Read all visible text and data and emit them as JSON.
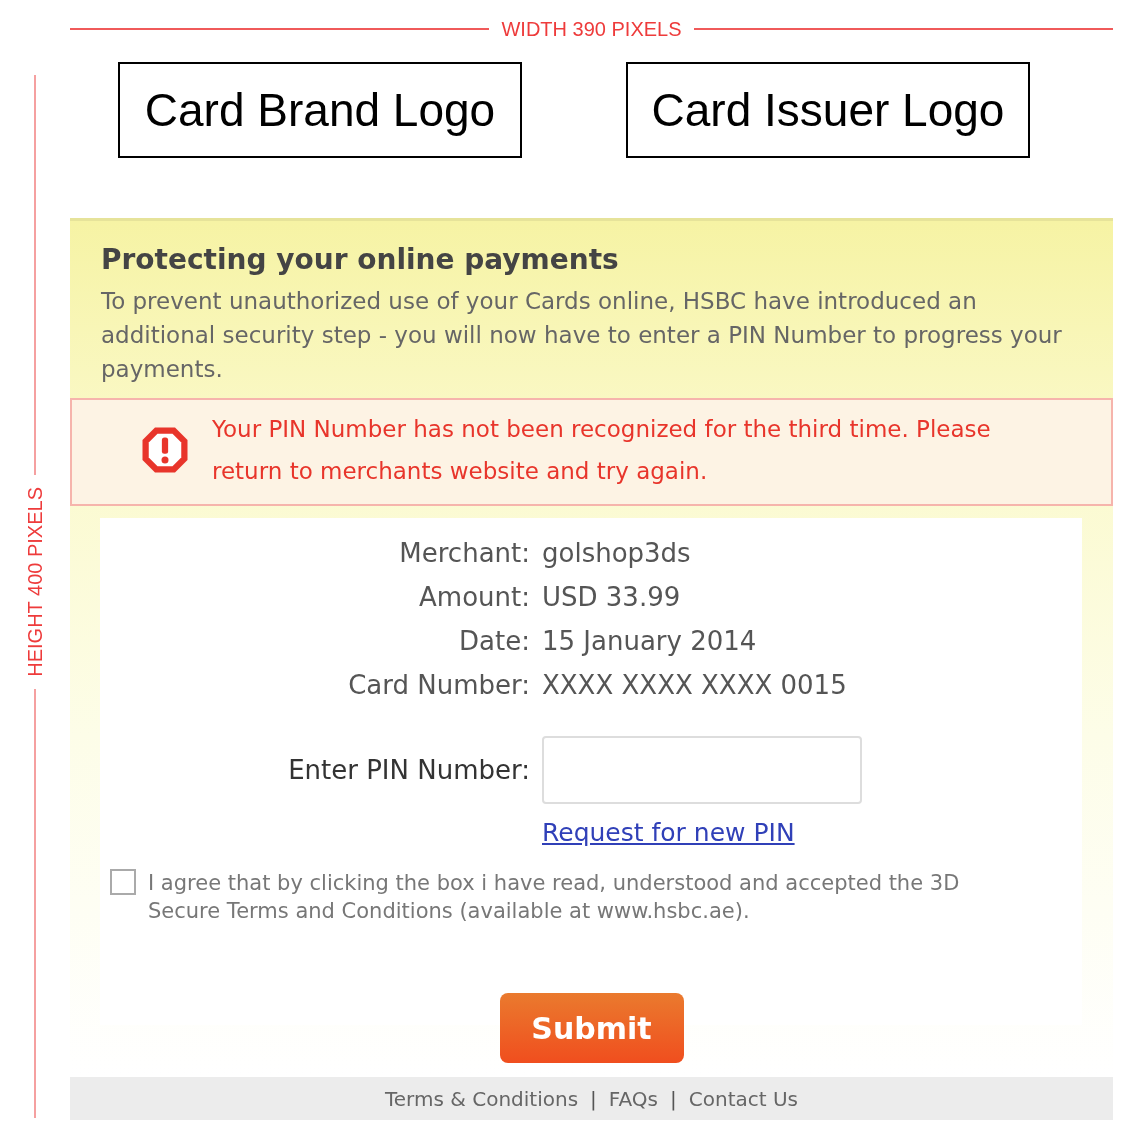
{
  "annotations": {
    "width_label": "WIDTH 390 PIXELS",
    "height_label": "HEIGHT 400 PIXELS"
  },
  "logos": [
    "Card Brand Logo",
    "Card Issuer Logo"
  ],
  "notice": {
    "title": "Protecting your online payments",
    "text": "To prevent unauthorized use of your Cards online, HSBC have introduced an additional security step - you will now have to enter a PIN Number to progress your payments."
  },
  "error": {
    "message": "Your PIN Number has not been recognized for the third time. Please return to merchants website and try again."
  },
  "details": [
    {
      "label": "Merchant:",
      "value": "golshop3ds"
    },
    {
      "label": "Amount:",
      "value": "USD 33.99"
    },
    {
      "label": "Date:",
      "value": "15 January 2014"
    },
    {
      "label": "Card Number:",
      "value": "XXXX XXXX XXXX 0015"
    }
  ],
  "pin": {
    "label": "Enter PIN Number:",
    "link": "Request for new PIN"
  },
  "agreement": {
    "checked": false,
    "text": "I agree that by clicking the box i have read, understood and accepted the 3D Secure Terms and Conditions (available at www.hsbc.ae)."
  },
  "submit": "Submit",
  "footer": [
    {
      "kind": "link",
      "text": "Terms & Conditions"
    },
    {
      "kind": "separator",
      "text": "|"
    },
    {
      "kind": "link",
      "text": "FAQs"
    },
    {
      "kind": "separator",
      "text": "|"
    },
    {
      "kind": "link",
      "text": "Contact Us"
    }
  ]
}
